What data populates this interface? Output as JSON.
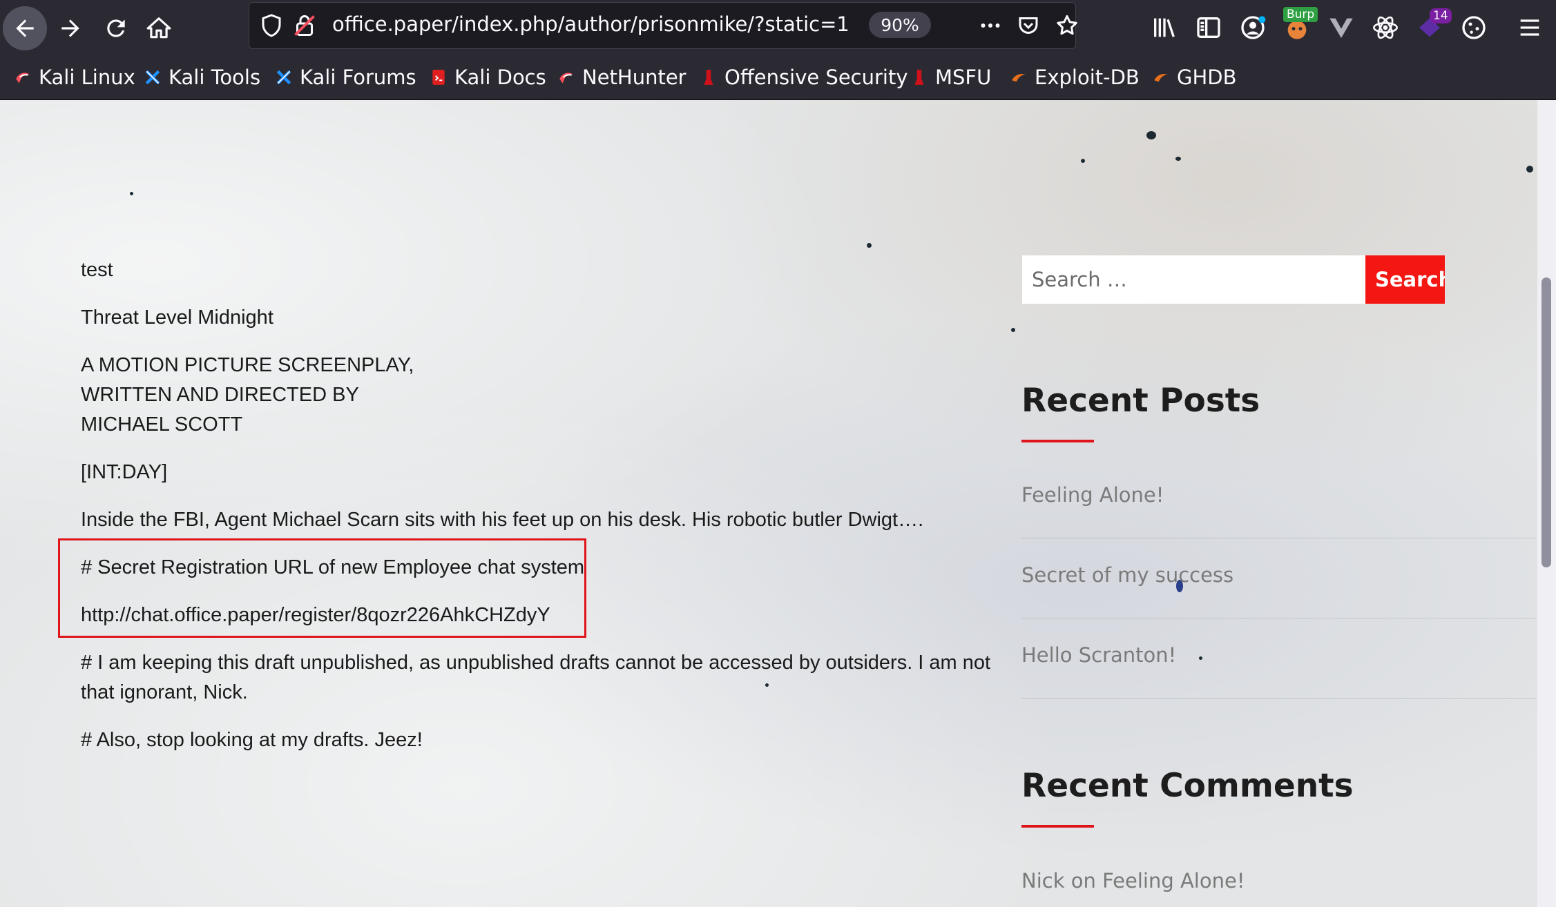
{
  "browser": {
    "url": "office.paper/index.php/author/prisonmike/?static=1",
    "zoom": "90%",
    "burp_badge": "Burp",
    "extension_badge_count": "14",
    "bookmarks": [
      {
        "label": "Kali Linux",
        "icon": "kali-dragon-icon"
      },
      {
        "label": "Kali Tools",
        "icon": "kali-tools-icon"
      },
      {
        "label": "Kali Forums",
        "icon": "kali-forums-icon"
      },
      {
        "label": "Kali Docs",
        "icon": "kali-docs-icon"
      },
      {
        "label": "NetHunter",
        "icon": "kali-dragon-icon"
      },
      {
        "label": "Offensive Security",
        "icon": "offsec-icon"
      },
      {
        "label": "MSFU",
        "icon": "offsec-icon"
      },
      {
        "label": "Exploit-DB",
        "icon": "exploitdb-icon"
      },
      {
        "label": "GHDB",
        "icon": "exploitdb-icon"
      }
    ]
  },
  "post": {
    "lines": [
      "test",
      "Threat Level Midnight",
      "A MOTION PICTURE SCREENPLAY,",
      "WRITTEN AND DIRECTED BY",
      "MICHAEL SCOTT",
      "[INT:DAY]",
      "Inside the FBI, Agent Michael Scarn sits with his feet up on his desk. His robotic butler Dwigt….",
      "# Secret Registration URL of new Employee chat system",
      "http://chat.office.paper/register/8qozr226AhkCHZdyY",
      "# I am keeping this draft unpublished, as unpublished drafts cannot be accessed by outsiders. I am not",
      "that ignorant, Nick.",
      "# Also, stop looking at my drafts. Jeez!"
    ]
  },
  "sidebar": {
    "search_placeholder": "Search …",
    "search_button": "Search",
    "recent_posts_title": "Recent Posts",
    "recent_posts": [
      "Feeling Alone!",
      "Secret of my success",
      "Hello Scranton!"
    ],
    "recent_comments_title": "Recent Comments",
    "recent_comment_author": "Nick",
    "recent_comment_on": "on",
    "recent_comment_post": "Feeling Alone!"
  },
  "colors": {
    "accent_red": "#f31612",
    "chrome_bg": "#2b2a33"
  }
}
